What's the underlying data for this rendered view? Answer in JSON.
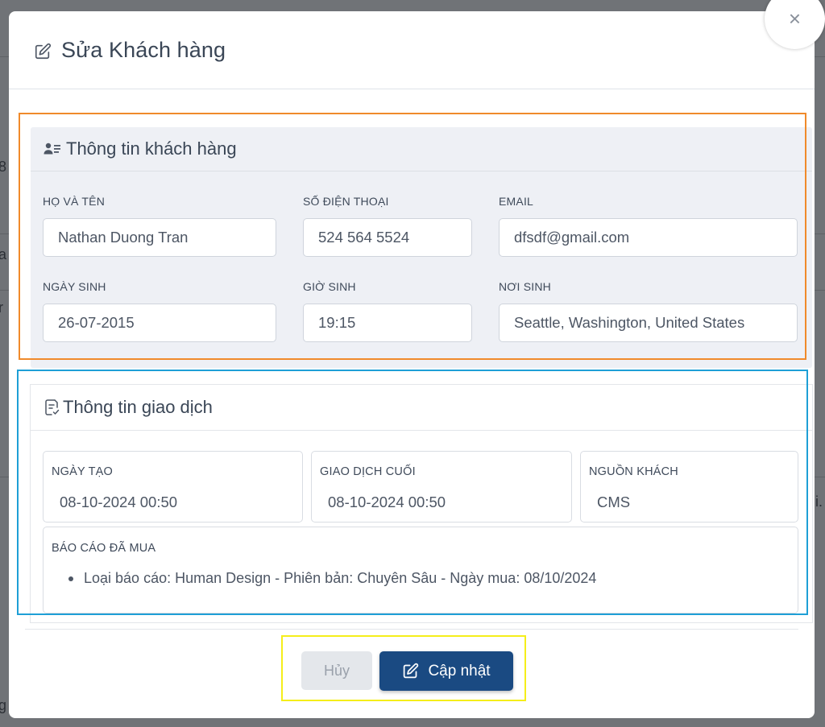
{
  "background": {
    "fragments": [
      "a",
      "r",
      "g",
      "i.",
      "8"
    ]
  },
  "modal": {
    "title": "Sửa Khách hàng",
    "close_icon": "×"
  },
  "customer_info": {
    "title": "Thông tin khách hàng",
    "fields": {
      "full_name": {
        "label": "HỌ VÀ TÊN",
        "value": "Nathan Duong Tran"
      },
      "phone": {
        "label": "SỐ ĐIỆN THOẠI",
        "value": "524 564 5524"
      },
      "email": {
        "label": "EMAIL",
        "value": "dfsdf@gmail.com"
      },
      "birth_date": {
        "label": "NGÀY SINH",
        "value": "26-07-2015"
      },
      "birth_time": {
        "label": "GIỜ SINH",
        "value": "19:15"
      },
      "birth_place": {
        "label": "NƠI SINH",
        "value": "Seattle, Washington, United States"
      }
    }
  },
  "transaction_info": {
    "title": "Thông tin giao dịch",
    "created": {
      "label": "NGÀY TẠO",
      "value": "08-10-2024 00:50"
    },
    "last_transaction": {
      "label": "GIAO DỊCH CUỐI",
      "value": "08-10-2024 00:50"
    },
    "source": {
      "label": "NGUỒN KHÁCH",
      "value": "CMS"
    },
    "reports": {
      "label": "BÁO CÁO ĐÃ MUA",
      "items": [
        "Loại báo cáo: Human Design - Phiên bản: Chuyên Sâu - Ngày mua: 08/10/2024"
      ]
    }
  },
  "footer": {
    "cancel_label": "Hủy",
    "update_label": "Cập nhật"
  },
  "colors": {
    "primary": "#1a4a82",
    "highlight_orange": "#f08a2b",
    "highlight_blue": "#1e9fd6",
    "highlight_yellow": "#f5ee1a"
  }
}
